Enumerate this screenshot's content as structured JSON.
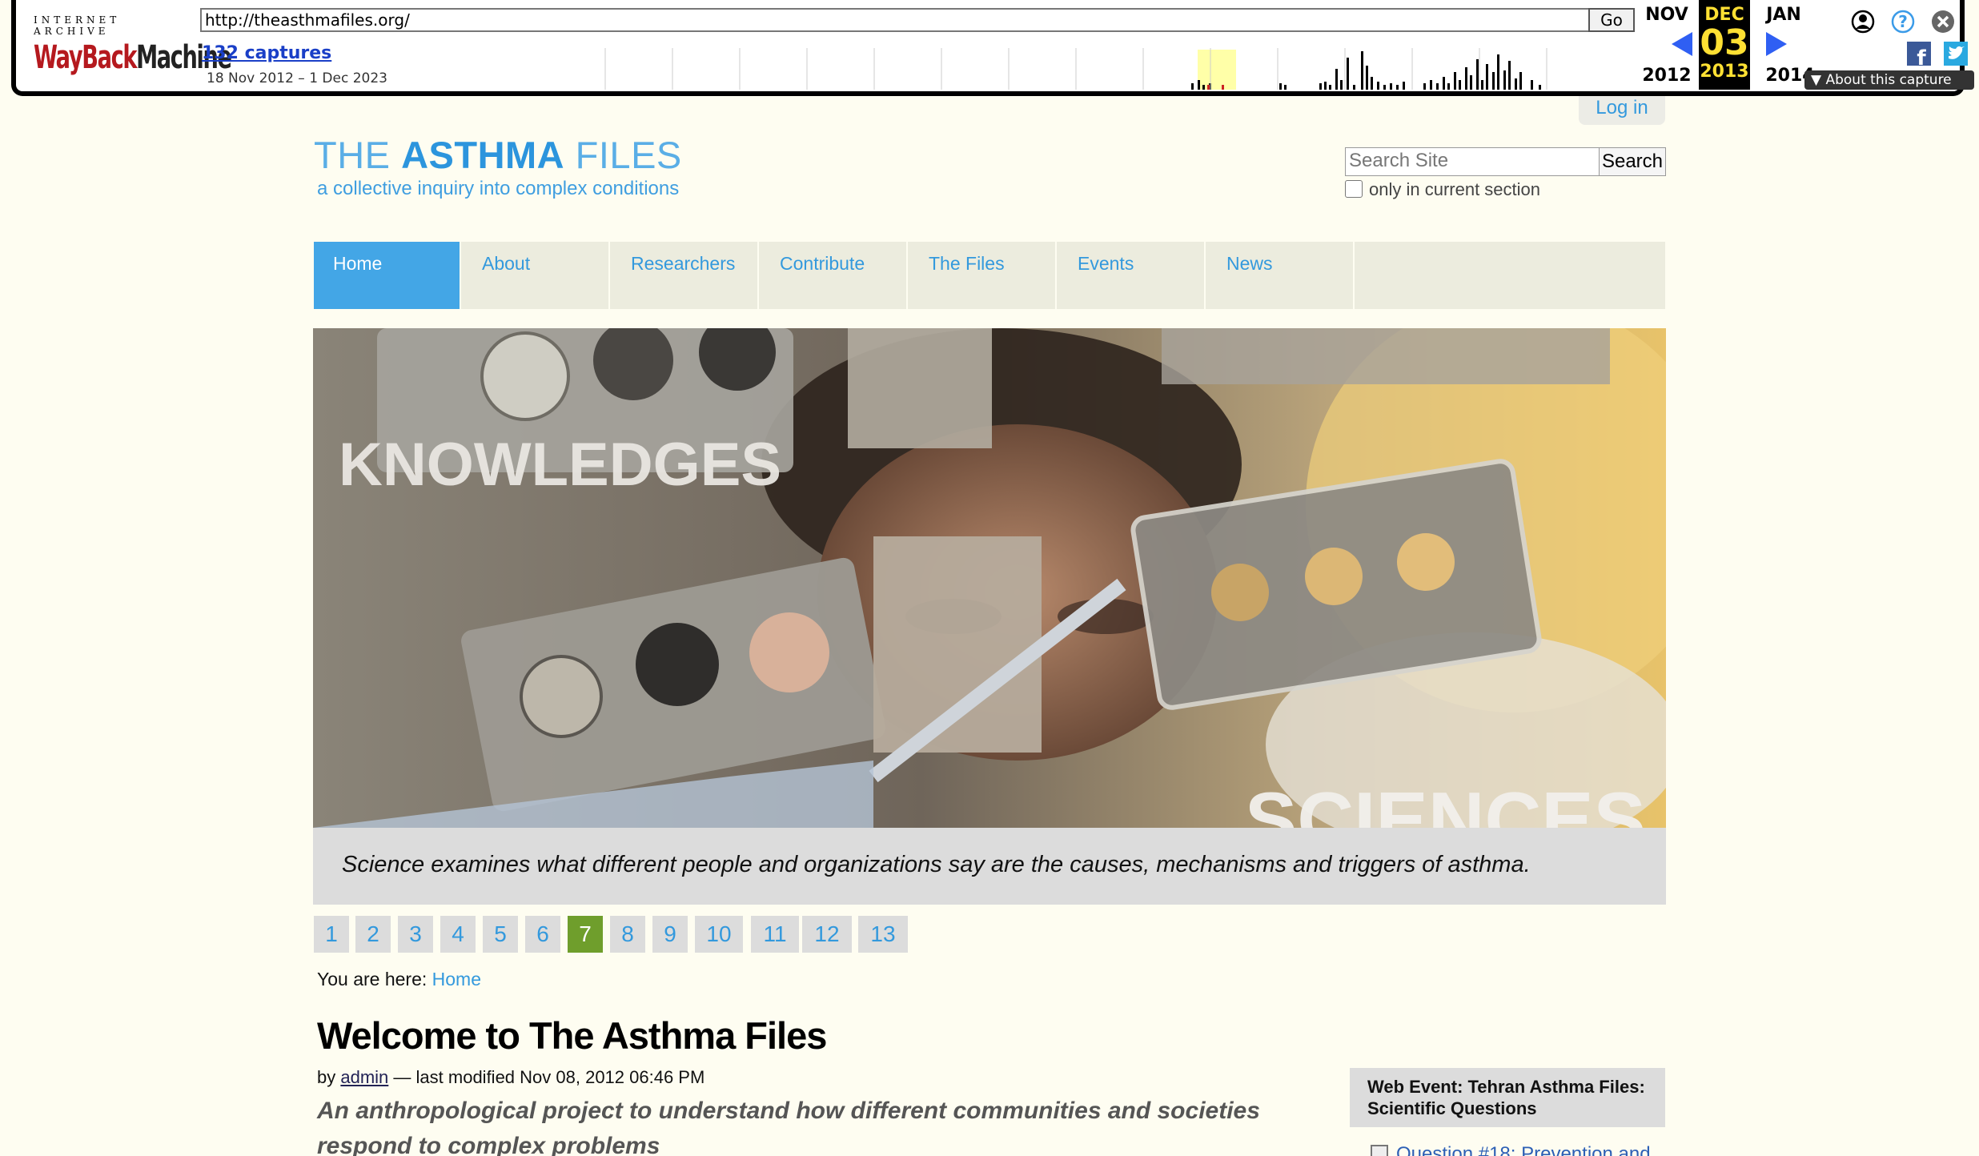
{
  "wayback": {
    "logo_top": "INTERNET ARCHIVE",
    "logo_main_red": "WayBack",
    "logo_main_dark": "Machine",
    "url": "http://theasthmafiles.org/",
    "go_label": "Go",
    "captures": "132 captures",
    "date_range": "18 Nov 2012 – 1 Dec 2023",
    "prev_month": "NOV",
    "cur_month": "DEC",
    "next_month": "JAN",
    "cur_day": "03",
    "prev_year": "2012",
    "cur_year": "2013",
    "next_year": "2014",
    "about_label": "About this capture",
    "icons": [
      "user-icon",
      "help-icon",
      "close-icon",
      "facebook-icon",
      "twitter-icon",
      "prev-arrow-icon",
      "next-arrow-icon"
    ]
  },
  "site": {
    "login_label": "Log in",
    "logo_pre": "THE ",
    "logo_bold": "ASTHMA",
    "logo_post": " FILES",
    "tagline": "a collective inquiry into complex conditions",
    "search_placeholder": "Search Site",
    "search_button": "Search",
    "only_section": "only in current section",
    "nav": [
      "Home",
      "About",
      "Researchers",
      "Contribute",
      "The Files",
      "Events",
      "News"
    ],
    "active_nav": "Home",
    "hero_word_top": "KNOWLEDGES",
    "hero_word_bottom": "SCIENCES",
    "caption": "Science examines what different people and organizations say are the causes, mechanisms and triggers of asthma.",
    "pages": [
      "1",
      "2",
      "3",
      "4",
      "5",
      "6",
      "7",
      "8",
      "9",
      "10",
      "11",
      "12",
      "13"
    ],
    "active_page": "7",
    "crumb_label": "You are here:",
    "crumb_link": "Home",
    "title": "Welcome to The Asthma Files",
    "by_label": "by",
    "author": "admin",
    "modified": "— last modified Nov 08, 2012 06:46 PM",
    "lead": "An anthropological project to understand how different communities and societies respond to complex problems",
    "portlet_title": "Web Event: Tehran Asthma Files: Scientific Questions",
    "portlet_item": "Question #18: Prevention and"
  },
  "colors": {
    "page_bg": "#fefdf1",
    "link": "#3399dd",
    "nav_active": "#43a6e6",
    "pager_active": "#6f9e2c",
    "wayback_red": "#b5191e",
    "wayback_highlight": "#ffe033"
  }
}
